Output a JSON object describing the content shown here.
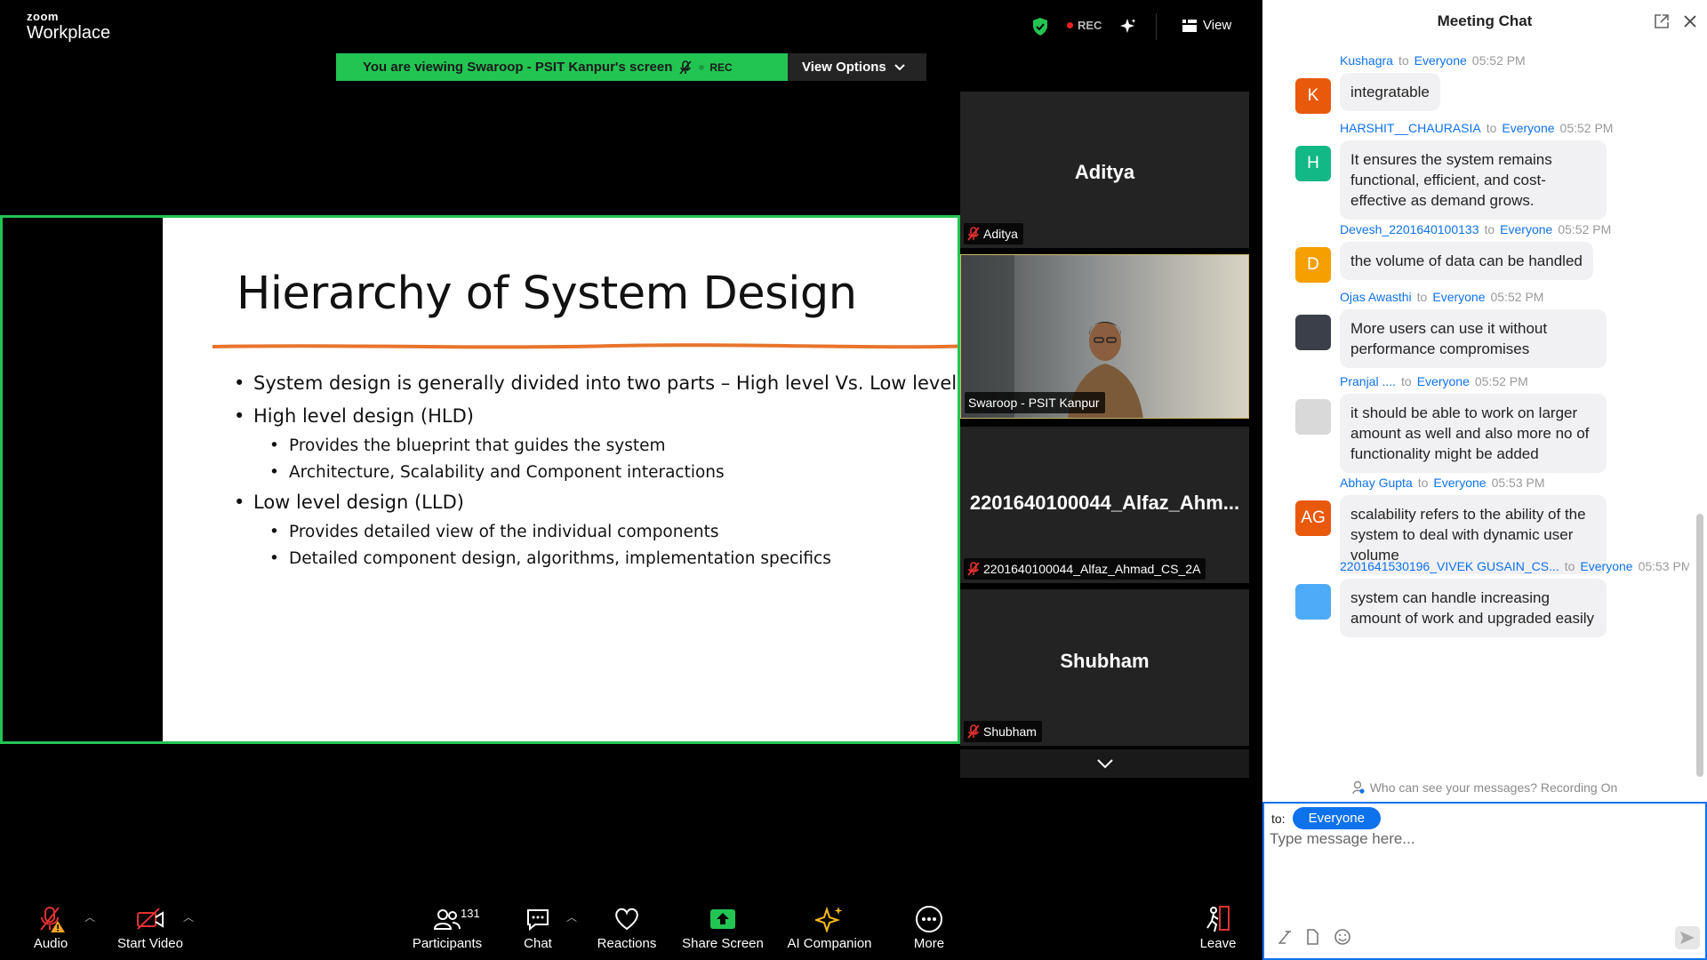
{
  "app": {
    "logo_small": "zoom",
    "logo_large": "Workplace"
  },
  "topbar": {
    "rec_label": "REC",
    "view_label": "View"
  },
  "share_banner": {
    "text": "You are viewing  Swaroop - PSIT Kanpur's screen",
    "rec_label": "REC",
    "options_label": "View Options"
  },
  "slide": {
    "title": "Hierarchy of System Design",
    "bullets": [
      "System design is generally divided into two parts – High level Vs. Low level",
      "High level design (HLD)",
      "Provides the blueprint that guides the system",
      "Architecture, Scalability and Component interactions",
      "Low level design (LLD)",
      "Provides detailed view of the individual components",
      "Detailed component design, algorithms, implementation specifics"
    ]
  },
  "gallery": {
    "tiles": [
      {
        "name": "Aditya",
        "tag": "Aditya"
      },
      {
        "name": "",
        "tag": "Swaroop - PSIT Kanpur"
      },
      {
        "name": "2201640100044_Alfaz_Ahm...",
        "tag": "2201640100044_Alfaz_Ahmad_CS_2A"
      },
      {
        "name": "Shubham",
        "tag": "Shubham"
      }
    ]
  },
  "toolbar": {
    "audio": "Audio",
    "video": "Start Video",
    "participants": "Participants",
    "participant_count": "131",
    "chat": "Chat",
    "reactions": "Reactions",
    "share": "Share Screen",
    "ai": "AI Companion",
    "more": "More",
    "leave": "Leave"
  },
  "chat": {
    "title": "Meeting Chat",
    "to_word": "to",
    "messages": [
      {
        "from": "Kushagra",
        "to": "Everyone",
        "time": "05:52 PM",
        "avatar": "K",
        "avatar_color": "#e8590c",
        "text": "integratable"
      },
      {
        "from": "HARSHIT__CHAURASIA",
        "to": "Everyone",
        "time": "05:52 PM",
        "avatar": "H",
        "avatar_color": "#12b886",
        "text": "It ensures the system remains functional, efficient, and cost-effective as demand grows."
      },
      {
        "from": "Devesh_2201640100133",
        "to": "Everyone",
        "time": "05:52 PM",
        "avatar": "D",
        "avatar_color": "#f59f00",
        "text": "the volume of data can be handled"
      },
      {
        "from": "Ojas Awasthi",
        "to": "Everyone",
        "time": "05:52 PM",
        "avatar": "",
        "avatar_color": "#3a3f4a",
        "text": "More users can use it without performance compromises"
      },
      {
        "from": "Pranjal ....",
        "to": "Everyone",
        "time": "05:52 PM",
        "avatar": "",
        "avatar_color": "#d9d9d9",
        "text": "it should be able to work on larger amount as well and also more no of functionality might be added"
      },
      {
        "from": "Abhay Gupta",
        "to": "Everyone",
        "time": "05:53 PM",
        "avatar": "AG",
        "avatar_color": "#e8590c",
        "text": "scalability refers to the ability of the system to deal with dynamic user volume"
      },
      {
        "from": "2201641530196_VIVEK GUSAIN_CS...",
        "to": "Everyone",
        "time": "05:53 PM",
        "avatar": "",
        "avatar_color": "#4dabf7",
        "text": "system can handle increasing amount of work and upgraded easily"
      }
    ],
    "visibility_note": "Who can see your messages? Recording On",
    "to_label": "to:",
    "recipient": "Everyone",
    "input_placeholder": "Type message here..."
  },
  "colors": {
    "accent": "#0e72ed",
    "share_green": "#23c552",
    "slide_rule": "#e8742c"
  }
}
